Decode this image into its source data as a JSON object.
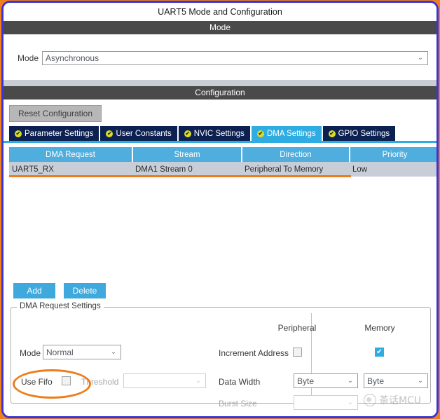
{
  "window": {
    "title": "UART5 Mode and Configuration",
    "border_color": "#3B34D6",
    "annotation_color": "#EE7C1B"
  },
  "mode_section": {
    "header": "Mode",
    "mode_label": "Mode",
    "mode_value": "Asynchronous",
    "chevron": "⌄"
  },
  "configuration_section": {
    "header": "Configuration",
    "reset_label": "Reset Configuration",
    "tabs": [
      {
        "label": "Parameter Settings",
        "bullet": "✔",
        "active": false
      },
      {
        "label": "User Constants",
        "bullet": "✔",
        "active": false
      },
      {
        "label": "NVIC Settings",
        "bullet": "✔",
        "active": false
      },
      {
        "label": "DMA Settings",
        "bullet": "✔",
        "active": true
      },
      {
        "label": "GPIO Settings",
        "bullet": "✔",
        "active": false
      }
    ],
    "active_tab": "DMA Settings",
    "tab_active_color": "#2FADE3",
    "tab_inactive_color": "#0C2151"
  },
  "dma_table": {
    "columns": [
      "DMA Request",
      "Stream",
      "Direction",
      "Priority"
    ],
    "rows": [
      {
        "dma_request": "UART5_RX",
        "stream": "DMA1 Stream 0",
        "direction": "Peripheral To Memory",
        "priority": "Low",
        "selected": true
      }
    ],
    "header_color": "#4FAEDD",
    "row_color": "#C8CED8"
  },
  "actions": {
    "add_label": "Add",
    "delete_label": "Delete",
    "button_color": "#3FA9DD"
  },
  "request_settings": {
    "group_title": "DMA Request Settings",
    "peripheral_column": "Peripheral",
    "memory_column": "Memory",
    "mode_label": "Mode",
    "mode_value": "Normal",
    "increment_address_label": "Increment Address",
    "increment_peripheral_checked": false,
    "increment_memory_checked": true,
    "use_fifo_label": "Use Fifo",
    "use_fifo_checked": false,
    "threshold_label": "Threshold",
    "threshold_value": "",
    "threshold_disabled": true,
    "data_width_label": "Data Width",
    "data_width_peripheral": "Byte",
    "data_width_memory": "Byte",
    "burst_size_label": "Burst Size",
    "burst_size_peripheral": "",
    "burst_size_disabled": true,
    "checkbox_checked_glyph": "✔",
    "chevron": "⌄"
  },
  "watermark": {
    "text": "茶话MCU"
  }
}
